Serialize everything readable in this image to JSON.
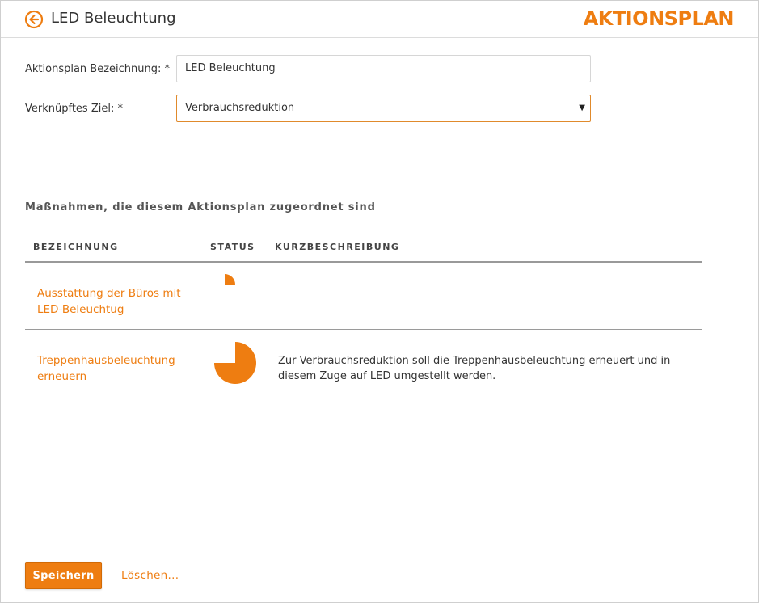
{
  "header": {
    "title": "LED Beleuchtung",
    "brand": "AKTIONSPLAN",
    "back_icon": "arrow-left-circle-icon"
  },
  "form": {
    "name_label": "Aktionsplan Bezeichnung: *",
    "name_value": "LED Beleuchtung",
    "goal_label": "Verknüpftes Ziel: *",
    "goal_value": "Verbrauchsreduktion"
  },
  "measures": {
    "section_title": "Maßnahmen, die diesem Aktionsplan zugeordnet sind",
    "columns": [
      "BEZEICHNUNG",
      "STATUS",
      "KURZBESCHREIBUNG"
    ],
    "rows": [
      {
        "name": "Ausstattung der Büros mit LED-Beleuchtug",
        "status_fraction": 0.25,
        "description": ""
      },
      {
        "name": "Treppenhausbeleuchtung erneuern",
        "status_fraction": 0.75,
        "description": "Zur Verbrauchsreduktion soll die Treppenhausbeleuchtung erneuert und in diesem Zuge auf LED umgestellt werden."
      }
    ]
  },
  "footer": {
    "save_label": "Speichern",
    "delete_label": "Löschen..."
  },
  "colors": {
    "accent": "#ee7d11",
    "text": "#333333"
  }
}
